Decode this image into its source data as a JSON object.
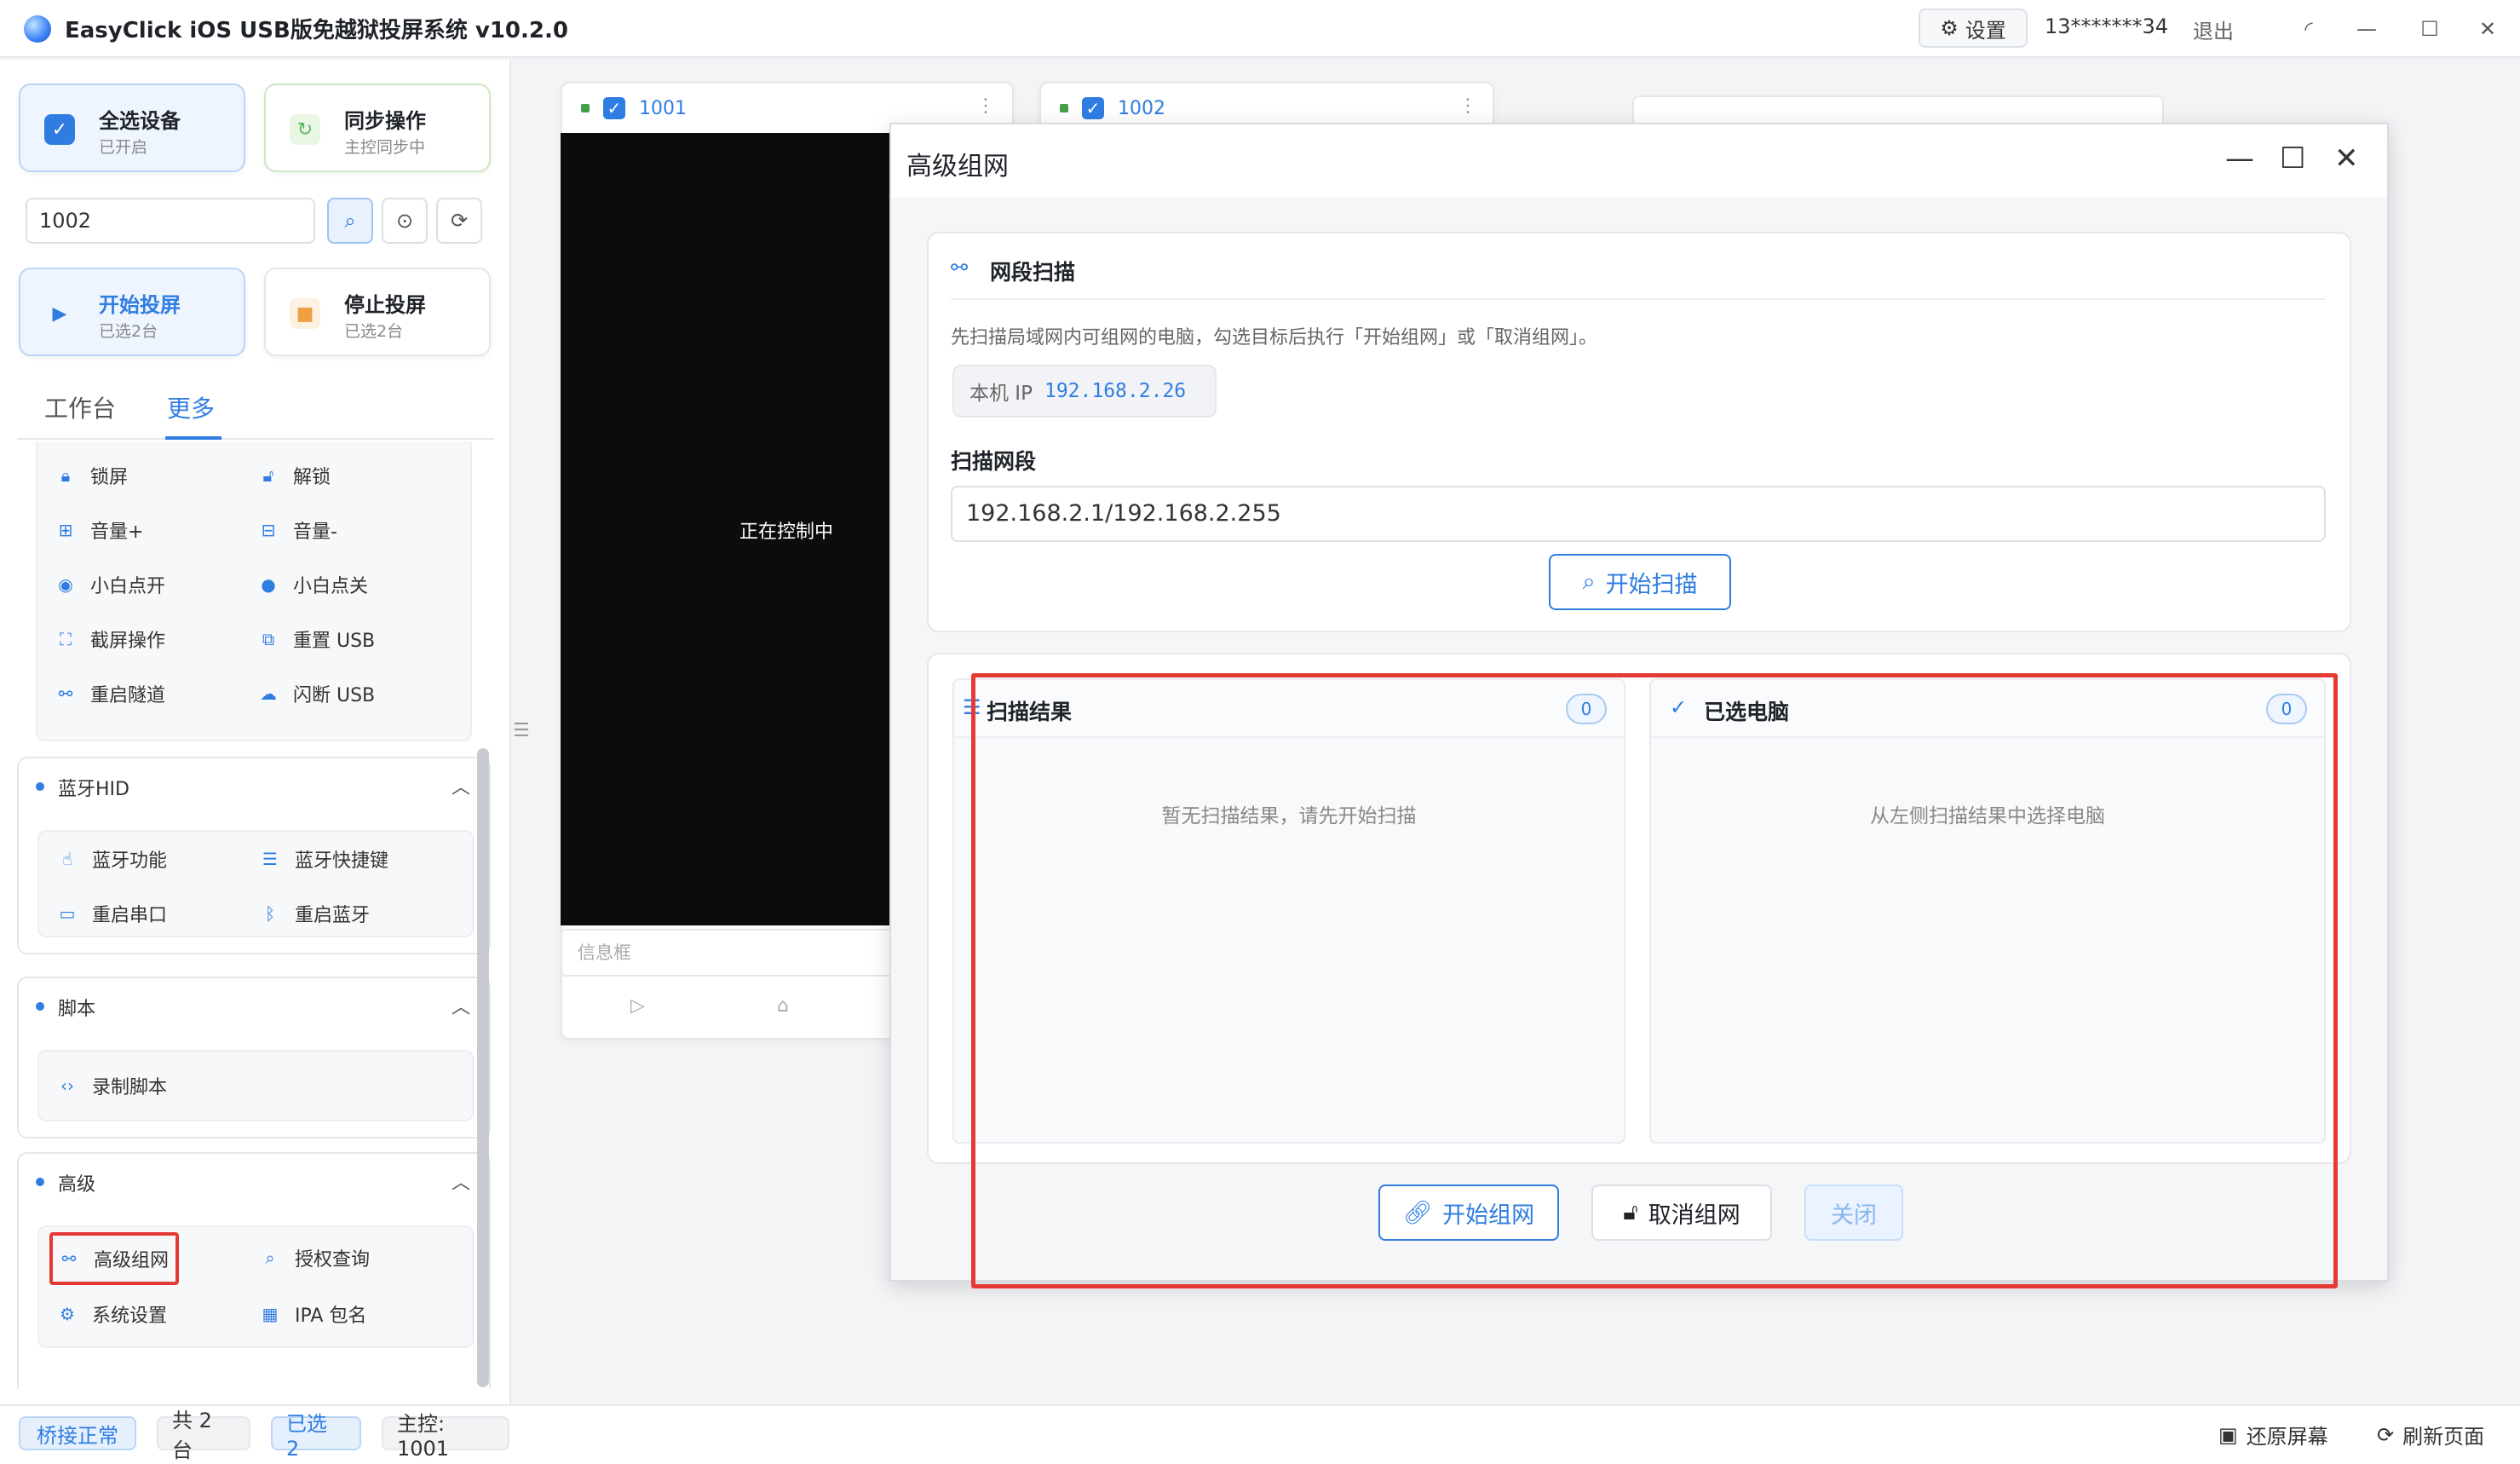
{
  "window": {
    "title": "EasyClick iOS USB版免越狱投屏系统 v10.2.0",
    "settings_label": "设置",
    "user": "13*******34",
    "logout": "退出"
  },
  "left": {
    "select_all": {
      "title": "全选设备",
      "sub": "已开启"
    },
    "sync": {
      "title": "同步操作",
      "sub": "主控同步中"
    },
    "search_value": "1002",
    "start_cast": {
      "title": "开始投屏",
      "sub": "已选2台"
    },
    "stop_cast": {
      "title": "停止投屏",
      "sub": "已选2台"
    },
    "tabs": [
      "工作台",
      "更多"
    ],
    "top_items": [
      "锁屏",
      "解锁",
      "音量+",
      "音量-",
      "小白点开",
      "小白点关",
      "截屏操作",
      "重置 USB",
      "重启隧道",
      "闪断 USB"
    ],
    "sections": [
      {
        "title": "蓝牙HID",
        "items": [
          "蓝牙功能",
          "蓝牙快捷键",
          "重启串口",
          "重启蓝牙"
        ]
      },
      {
        "title": "脚本",
        "items": [
          "录制脚本"
        ]
      },
      {
        "title": "高级",
        "items": [
          "高级组网",
          "授权查询",
          "系统设置",
          "IPA 包名"
        ]
      }
    ]
  },
  "devices": [
    {
      "name": "1001",
      "status": "正在控制中",
      "info_placeholder": "信息框"
    },
    {
      "name": "1002"
    }
  ],
  "dialog": {
    "title": "高级组网",
    "scan_title": "网段扫描",
    "desc": "先扫描局域网内可组网的电脑，勾选目标后执行「开始组网」或「取消组网」。",
    "ip_label": "本机 IP",
    "ip_value": "192.168.2.26",
    "range_label": "扫描网段",
    "range_value": "192.168.2.1/192.168.2.255",
    "scan_button": "开始扫描",
    "results_title": "扫描结果",
    "results_count": "0",
    "results_empty": "暂无扫描结果，请先开始扫描",
    "selected_title": "已选电脑",
    "selected_count": "0",
    "selected_empty": "从左侧扫描结果中选择电脑",
    "start_net": "开始组网",
    "cancel_net": "取消组网",
    "close": "关闭"
  },
  "status": {
    "bridge": "桥接正常",
    "total": "共 2 台",
    "selected": "已选 2",
    "master": "主控: 1001",
    "restore": "还原屏幕",
    "refresh": "刷新页面"
  },
  "colors": {
    "accent": "#2f7de1",
    "highlight": "#e53935"
  }
}
